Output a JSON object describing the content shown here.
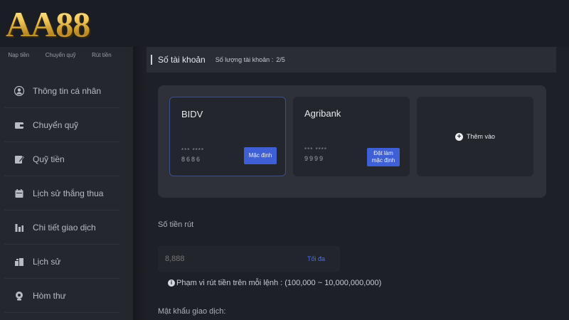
{
  "brand": {
    "logo_text": "AA88",
    "logo_color": "#e3b84a"
  },
  "quick_links": [
    "Nạp tiền",
    "Chuyển quỹ",
    "Rút tiền"
  ],
  "sidebar": {
    "items": [
      {
        "label": "Thông tin cá nhân",
        "icon": "user-icon"
      },
      {
        "label": "Chuyển quỹ",
        "icon": "wallet-icon"
      },
      {
        "label": "Quỹ tiền",
        "icon": "edit-icon"
      },
      {
        "label": "Lịch sử thắng thua",
        "icon": "calendar-icon"
      },
      {
        "label": "Chi tiết giao dịch",
        "icon": "bar-chart-icon"
      },
      {
        "label": "Lịch sử",
        "icon": "history-icon"
      },
      {
        "label": "Hòm thư",
        "icon": "mail-icon"
      }
    ]
  },
  "section": {
    "title": "Số tài khoản",
    "count_label": "Số lượng tài khoản :",
    "count_value": "2/5"
  },
  "cards": [
    {
      "bank": "BIDV",
      "mask": "*** ****",
      "number": "8686",
      "button": "Mặc định",
      "selected": true
    },
    {
      "bank": "Agribank",
      "mask": "*** ****",
      "number": "9999",
      "button_line1": "Đặt làm",
      "button_line2": "mặc định",
      "selected": false
    }
  ],
  "add_card": {
    "label": "Thêm vào",
    "icon": "plus-circle-icon"
  },
  "withdraw": {
    "amount_label": "Số tiền rút",
    "amount_placeholder": "8,888",
    "max_label": "Tối đa",
    "range_note": "Phạm vi rút tiền trên mỗi lệnh : (100,000 ~ 10,000,000,000)",
    "password_label": "Mật khẩu giao dịch:"
  },
  "colors": {
    "accent": "#3f5fd6",
    "background": "#1e2028",
    "panel": "#2f313a"
  }
}
